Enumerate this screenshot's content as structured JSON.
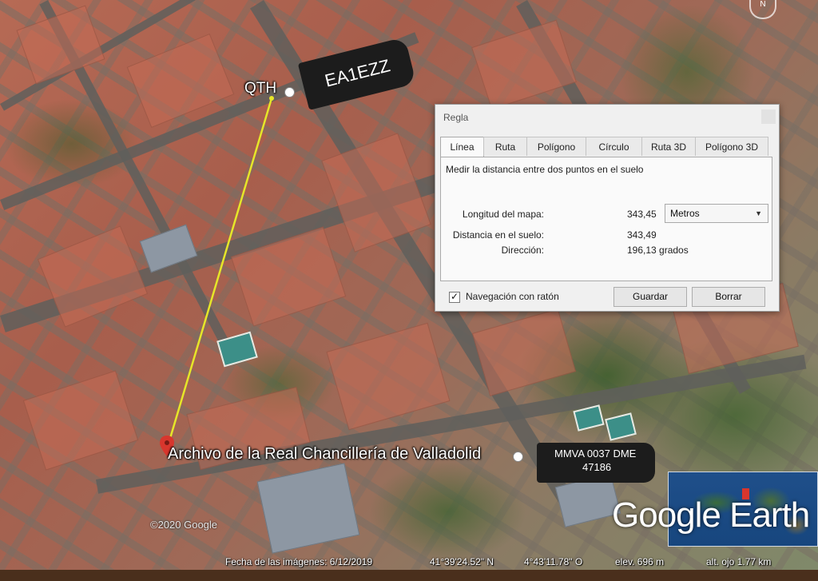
{
  "map": {
    "qth_label": "QTH",
    "callsign_tag": "EA1EZZ",
    "archive_label": "Archivo de la Real Chancillería de Valladolid",
    "station_tag_line1": "MMVA 0037 DME",
    "station_tag_line2": "47186",
    "copyright": "©2020 Google",
    "logo": "Google Earth",
    "compass_letter": "N",
    "line_color": "#e6e629",
    "pin_color": "#d8362d"
  },
  "dialog": {
    "title": "Regla",
    "tabs": [
      {
        "label": "Línea",
        "active": true
      },
      {
        "label": "Ruta",
        "active": false
      },
      {
        "label": "Polígono",
        "active": false
      },
      {
        "label": "Círculo",
        "active": false
      },
      {
        "label": "Ruta 3D",
        "active": false
      },
      {
        "label": "Polígono 3D",
        "active": false
      }
    ],
    "description": "Medir la distancia entre dos puntos en el suelo",
    "map_length_label": "Longitud del mapa:",
    "map_length_value": "343,45",
    "unit_selected": "Metros",
    "ground_distance_label": "Distancia en el suelo:",
    "ground_distance_value": "343,49",
    "direction_label": "Dirección:",
    "direction_value": "196,13 grados",
    "mouse_nav_label": "Navegación con ratón",
    "mouse_nav_checked": "✓",
    "save_button": "Guardar",
    "clear_button": "Borrar"
  },
  "status_bar": {
    "imagery_date": "Fecha de las imágenes: 6/12/2019",
    "latitude": "41°39'24.52\" N",
    "longitude": "4°43'11.78\" O",
    "elevation": "elev.  696 m",
    "eye_altitude": "alt. ojo  1.77 km"
  }
}
